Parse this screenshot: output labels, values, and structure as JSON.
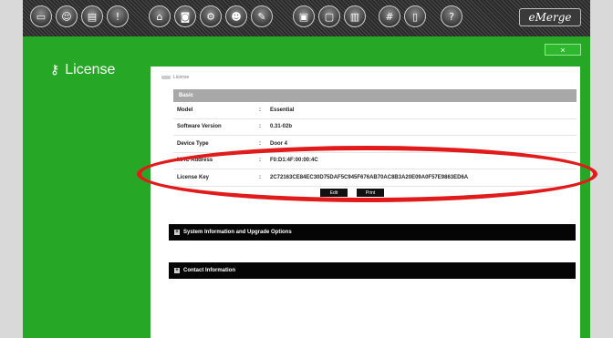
{
  "toolbar": {
    "buttons": [
      {
        "icon": "monitor-icon",
        "glyph": "▭"
      },
      {
        "icon": "user-icon",
        "glyph": "☺"
      },
      {
        "icon": "card-icon",
        "glyph": "▤"
      },
      {
        "icon": "alert-icon",
        "glyph": "!"
      },
      {
        "icon": "door-icon",
        "glyph": "⌂"
      },
      {
        "icon": "camera-icon",
        "glyph": "◙"
      },
      {
        "icon": "settings-icon",
        "glyph": "⚙"
      },
      {
        "icon": "people-icon",
        "glyph": "☻"
      },
      {
        "icon": "wrench-icon",
        "glyph": "✎"
      },
      {
        "icon": "report-icon",
        "glyph": "▣"
      },
      {
        "icon": "document-icon",
        "glyph": "▢"
      },
      {
        "icon": "chart-icon",
        "glyph": "▥"
      },
      {
        "icon": "keypad-icon",
        "glyph": "#"
      },
      {
        "icon": "floorplan-icon",
        "glyph": "▯"
      },
      {
        "icon": "help-icon",
        "glyph": "?"
      }
    ],
    "brand": "eMerge"
  },
  "window": {
    "close_label": "×"
  },
  "page": {
    "title": "License"
  },
  "breadcrumb": {
    "label": "License"
  },
  "basic": {
    "header": "Basic",
    "rows": [
      {
        "label": "Model",
        "value": "Essential"
      },
      {
        "label": "Software Version",
        "value": "0.31-02b"
      },
      {
        "label": "Device Type",
        "value": "Door 4"
      },
      {
        "label": "MAC Address",
        "value": "F0:D1:4F:00:00:4C"
      },
      {
        "label": "License Key",
        "value": "2C72163CE84EC30D75DAF5C945F676AB70AC8B3A20E09A0F57E9863ED6A"
      }
    ]
  },
  "actions": {
    "edit_label": "Edit",
    "print_label": "Print"
  },
  "panels": {
    "system_info": "System Information and Upgrade Options",
    "contact_info": "Contact Information"
  },
  "annotation": {
    "color": "#e11b1b"
  }
}
